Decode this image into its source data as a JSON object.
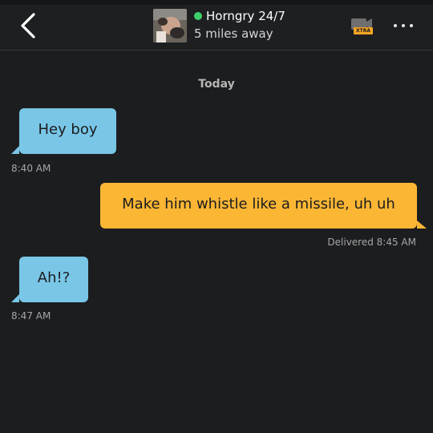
{
  "header": {
    "back_icon": "chevron-left-icon",
    "profile_name": "Horngry 24/7",
    "distance": "5 miles away",
    "online_color": "#3fcf6a",
    "xtra_badge": "XTRA",
    "more_icon": "more-horizontal-icon"
  },
  "chat": {
    "day_label": "Today",
    "messages": [
      {
        "direction": "incoming",
        "text": "Hey boy",
        "meta": "8:40 AM",
        "color": "#79c6e7"
      },
      {
        "direction": "outgoing",
        "text": "Make him whistle like a missile, uh uh",
        "meta": "Delivered 8:45 AM",
        "color": "#fbb634"
      },
      {
        "direction": "incoming",
        "text": "Ah!?",
        "meta": "8:47 AM",
        "color": "#79c6e7"
      }
    ]
  },
  "colors": {
    "background": "#1c1d1f",
    "header_background": "#1e1f21",
    "incoming_bubble": "#79c6e7",
    "outgoing_bubble": "#fbb634"
  }
}
